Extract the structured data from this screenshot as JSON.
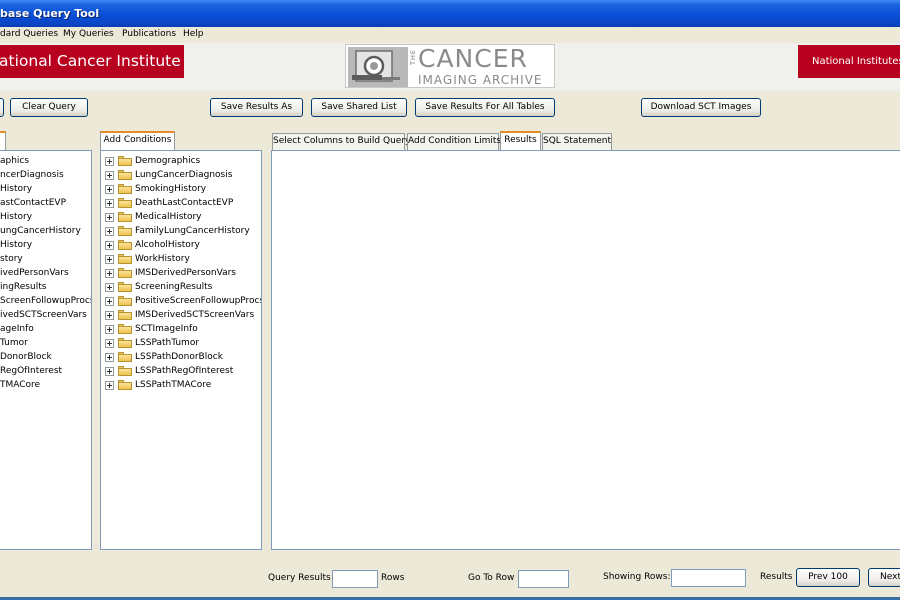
{
  "window": {
    "title": "base Query Tool"
  },
  "menu": [
    "dard Queries",
    "My Queries",
    "Publications",
    "Help"
  ],
  "banner": {
    "left_logo": "ational Cancer Institute",
    "center_logo": {
      "the": "THE",
      "line1": "CANCER",
      "line2": "IMAGING ARCHIVE"
    },
    "right_logo": "National Institutes"
  },
  "toolbar": {
    "clear_query": "Clear Query",
    "save_results_as": "Save Results As",
    "save_shared_list": "Save Shared List",
    "save_results_all": "Save Results For All Tables",
    "download_sct": "Download SCT Images"
  },
  "left_tree": {
    "items": [
      "aphics",
      "ncerDiagnosis",
      "History",
      "astContactEVP",
      "History",
      "ungCancerHistory",
      "History",
      "story",
      "ivedPersonVars",
      "ingResults",
      "ScreenFollowupProcs",
      "ivedSCTScreenVars",
      "ageInfo",
      "Tumor",
      "DonorBlock",
      "RegOfInterest",
      "TMACore"
    ]
  },
  "conditions": {
    "tab_label": "Add Conditions",
    "items": [
      "Demographics",
      "LungCancerDiagnosis",
      "SmokingHistory",
      "DeathLastContactEVP",
      "MedicalHistory",
      "FamilyLungCancerHistory",
      "AlcoholHistory",
      "WorkHistory",
      "IMSDerivedPersonVars",
      "ScreeningResults",
      "PositiveScreenFollowupProcs",
      "IMSDerivedSCTScreenVars",
      "SCTImageInfo",
      "LSSPathTumor",
      "LSSPathDonorBlock",
      "LSSPathRegOfInterest",
      "LSSPathTMACore"
    ]
  },
  "main_tabs": [
    {
      "label": "Select Columns to Build Query",
      "active": false
    },
    {
      "label": "Add Condition Limits",
      "active": false
    },
    {
      "label": "Results",
      "active": true
    },
    {
      "label": "SQL Statement",
      "active": false
    }
  ],
  "statusbar": {
    "query_results": "Query Results",
    "rows": "Rows",
    "go_to_row": "Go To Row",
    "showing_rows": "Showing Rows:",
    "results": "Results",
    "prev": "Prev 100",
    "next": "Next"
  }
}
